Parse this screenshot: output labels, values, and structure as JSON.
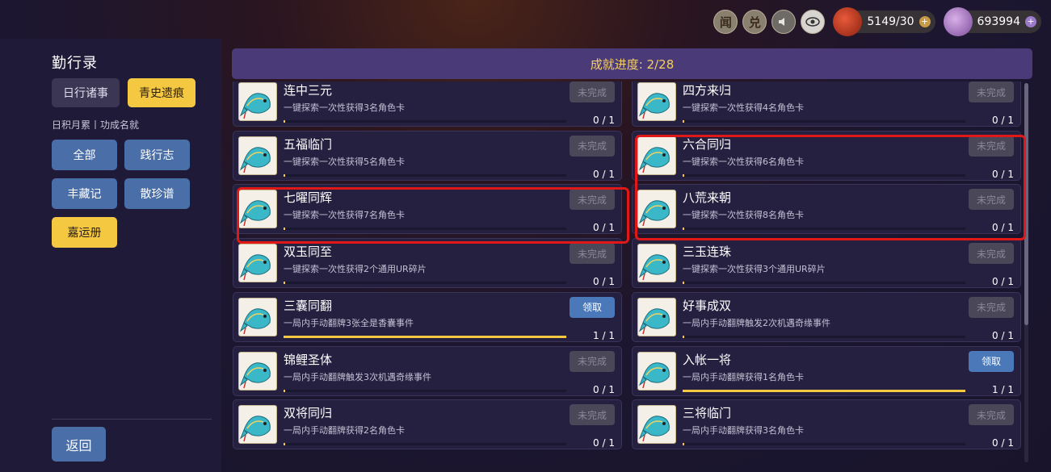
{
  "topbar": {
    "btn_news": "闻",
    "btn_exchange": "兑",
    "currency1": {
      "icon": "red-bag-icon",
      "value": "5149/30",
      "plus": "+"
    },
    "currency2": {
      "icon": "character-avatar-icon",
      "value": "693994",
      "plus": "+"
    }
  },
  "left": {
    "title": "勤行录",
    "tabs": [
      "日行诸事",
      "青史遗痕"
    ],
    "subtitle": "日积月累丨功成名就",
    "filters": [
      "全部",
      "践行志",
      "丰藏记",
      "散珍谱",
      "嘉运册"
    ],
    "back": "返回"
  },
  "progress": "成就进度: 2/28",
  "colors": {
    "accent_yellow": "#f5c842",
    "highlight_red": "#e01818",
    "claim_blue": "#4a78b8"
  },
  "status_labels": {
    "incomplete": "未完成",
    "claim": "领取"
  },
  "cards": [
    {
      "name": "连中三元",
      "desc": "一键探索一次性获得3名角色卡",
      "status": "未完成",
      "progress": "0 / 1",
      "fill": 0
    },
    {
      "name": "四方来归",
      "desc": "一键探索一次性获得4名角色卡",
      "status": "未完成",
      "progress": "0 / 1",
      "fill": 0
    },
    {
      "name": "五福临门",
      "desc": "一键探索一次性获得5名角色卡",
      "status": "未完成",
      "progress": "0 / 1",
      "fill": 0
    },
    {
      "name": "六合同归",
      "desc": "一键探索一次性获得6名角色卡",
      "status": "未完成",
      "progress": "0 / 1",
      "fill": 0
    },
    {
      "name": "七曜同辉",
      "desc": "一键探索一次性获得7名角色卡",
      "status": "未完成",
      "progress": "0 / 1",
      "fill": 0
    },
    {
      "name": "八荒来朝",
      "desc": "一键探索一次性获得8名角色卡",
      "status": "未完成",
      "progress": "0 / 1",
      "fill": 0
    },
    {
      "name": "双玉同至",
      "desc": "一键探索一次性获得2个通用UR碎片",
      "status": "未完成",
      "progress": "0 / 1",
      "fill": 0
    },
    {
      "name": "三玉连珠",
      "desc": "一键探索一次性获得3个通用UR碎片",
      "status": "未完成",
      "progress": "0 / 1",
      "fill": 0
    },
    {
      "name": "三囊同翻",
      "desc": "一局内手动翻牌3张全是香囊事件",
      "status": "领取",
      "progress": "1 / 1",
      "fill": 1
    },
    {
      "name": "好事成双",
      "desc": "一局内手动翻牌触发2次机遇奇缘事件",
      "status": "未完成",
      "progress": "0 / 1",
      "fill": 0
    },
    {
      "name": "锦鲤圣体",
      "desc": "一局内手动翻牌触发3次机遇奇缘事件",
      "status": "未完成",
      "progress": "0 / 1",
      "fill": 0
    },
    {
      "name": "入帐一将",
      "desc": "一局内手动翻牌获得1名角色卡",
      "status": "领取",
      "progress": "1 / 1",
      "fill": 1
    },
    {
      "name": "双将同归",
      "desc": "一局内手动翻牌获得2名角色卡",
      "status": "未完成",
      "progress": "0 / 1",
      "fill": 0
    },
    {
      "name": "三将临门",
      "desc": "一局内手动翻牌获得3名角色卡",
      "status": "未完成",
      "progress": "0 / 1",
      "fill": 0
    }
  ]
}
